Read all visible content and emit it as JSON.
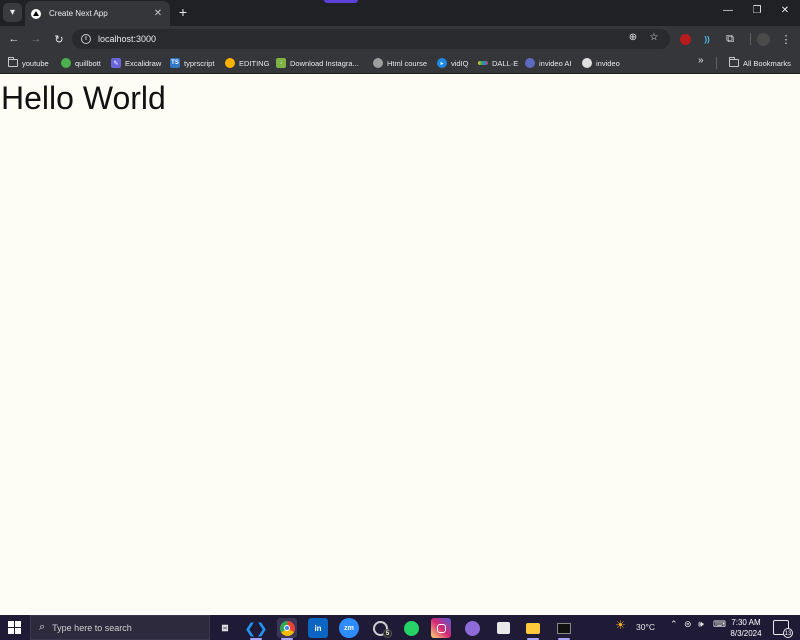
{
  "browser": {
    "tab": {
      "title": "Create Next App",
      "favicon": "nextjs-logo-icon"
    },
    "address": {
      "url": "localhost:3000"
    },
    "bookmarks": [
      {
        "label": "youtube",
        "icon": "folder-icon"
      },
      {
        "label": "quillbott",
        "icon": "quillbot-icon",
        "color": "#4caf50"
      },
      {
        "label": "Excalidraw",
        "icon": "excalidraw-icon",
        "color": "#6965db"
      },
      {
        "label": "typrscript",
        "icon": "typescript-icon",
        "color": "#3178c6"
      },
      {
        "label": "EDITING",
        "icon": "editing-icon",
        "color": "#ffb300"
      },
      {
        "label": "Download Instagra...",
        "icon": "download-icon",
        "color": "#7cb342"
      },
      {
        "label": "Html course",
        "icon": "globe-icon",
        "color": "#9e9e9e"
      },
      {
        "label": "vidIQ",
        "icon": "vidiq-icon",
        "color": "#1e88e5"
      },
      {
        "label": "DALL·E",
        "icon": "dalle-icon",
        "color": "#43a047"
      },
      {
        "label": "invideo AI",
        "icon": "invideo-ai-icon",
        "color": "#5c6bc0"
      },
      {
        "label": "invideo",
        "icon": "invideo-icon",
        "color": "#e0e0e0"
      }
    ],
    "all_bookmarks_label": "All Bookmarks"
  },
  "page": {
    "heading": "Hello World"
  },
  "taskbar": {
    "search_placeholder": "Type here to search",
    "whatsapp_badge": "5",
    "weather": "30°C",
    "time": "7:30 AM",
    "date": "8/3/2024",
    "notification_count": "13"
  },
  "colors": {
    "page_background": "#fdfdf6",
    "chrome_dark": "#202124",
    "toolbar": "#35363a",
    "taskbar": "#1f1a36"
  }
}
